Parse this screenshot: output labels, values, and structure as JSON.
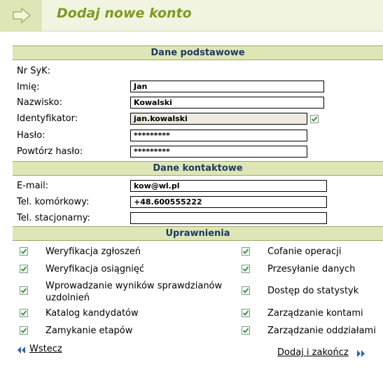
{
  "header": {
    "title": "Dodaj nowe konto"
  },
  "sections": {
    "basic": "Dane podstawowe",
    "contact": "Dane kontaktowe",
    "permissions": "Uprawnienia"
  },
  "basic": {
    "nr_syk_label": "Nr SyK:",
    "imie_label": "Imię:",
    "imie_value": "Jan",
    "nazwisko_label": "Nazwisko:",
    "nazwisko_value": "Kowalski",
    "identyfikator_label": "Identyfikator:",
    "identyfikator_value": "jan.kowalski",
    "identyfikator_checked": true,
    "haslo_label": "Hasło:",
    "haslo_value": "*********",
    "powtorz_label": "Powtórz hasło:",
    "powtorz_value": "*********"
  },
  "contact": {
    "email_label": "E-mail:",
    "email_value": "kow@wl.pl",
    "mobile_label": "Tel. komórkowy:",
    "mobile_value": "+48.600555222",
    "landline_label": "Tel. stacjonarny:",
    "landline_value": ""
  },
  "permissions": {
    "left": [
      {
        "label": "Weryfikacja zgłoszeń",
        "checked": true
      },
      {
        "label": "Weryfikacja osiągnięć",
        "checked": true
      },
      {
        "label": "Wprowadzanie wyników sprawdzianów uzdolnień",
        "checked": true
      },
      {
        "label": "Katalog kandydatów",
        "checked": true
      },
      {
        "label": "Zamykanie etapów",
        "checked": true
      }
    ],
    "right": [
      {
        "label": "Cofanie operacji",
        "checked": true
      },
      {
        "label": "Przesyłanie danych",
        "checked": true
      },
      {
        "label": "Dostęp do statystyk",
        "checked": true
      },
      {
        "label": "Zarządzanie kontami",
        "checked": true
      },
      {
        "label": "Zarządzanie oddziałami",
        "checked": true
      }
    ]
  },
  "nav": {
    "back": "Wstecz",
    "submit": "Dodaj i zakończ"
  },
  "colors": {
    "accent": "#7c9b1c",
    "section_bg": "#dfe6b6",
    "section_text": "#1b3a63",
    "check": "#3a9a3a"
  }
}
